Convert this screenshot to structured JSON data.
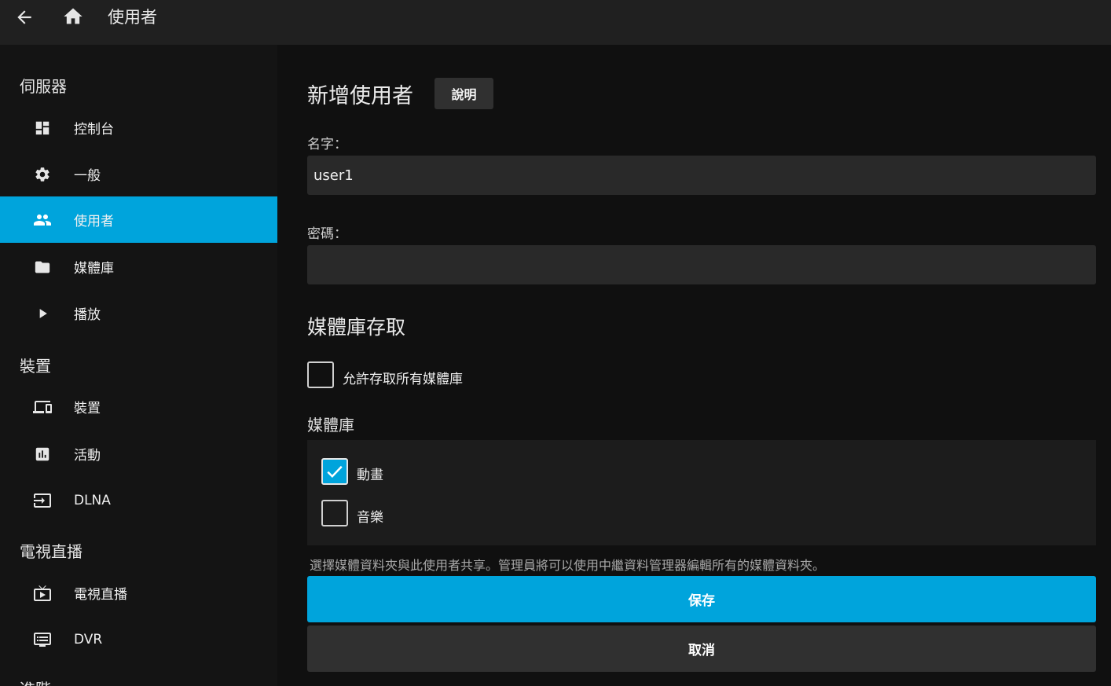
{
  "header": {
    "back_icon": "arrow-left-icon",
    "home_icon": "home-icon",
    "title": "使用者"
  },
  "sidebar": {
    "sections": [
      {
        "title": "伺服器"
      },
      {
        "title": "裝置"
      },
      {
        "title": "電視直播"
      },
      {
        "title": "進階"
      }
    ],
    "items": [
      {
        "label": "控制台",
        "icon": "dashboard-icon"
      },
      {
        "label": "一般",
        "icon": "gear-icon"
      },
      {
        "label": "使用者",
        "icon": "people-icon",
        "active": true
      },
      {
        "label": "媒體庫",
        "icon": "folder-icon"
      },
      {
        "label": "播放",
        "icon": "play-icon"
      },
      {
        "label": "裝置",
        "icon": "devices-icon"
      },
      {
        "label": "活動",
        "icon": "chart-icon"
      },
      {
        "label": "DLNA",
        "icon": "input-icon"
      },
      {
        "label": "電視直播",
        "icon": "tv-icon"
      },
      {
        "label": "DVR",
        "icon": "dvr-icon"
      }
    ]
  },
  "main": {
    "heading": "新增使用者",
    "help_label": "說明",
    "name_label": "名字：",
    "name_value": "user1",
    "password_label": "密碼：",
    "password_value": "",
    "library_access_heading": "媒體庫存取",
    "allow_all_label": "允許存取所有媒體庫",
    "allow_all_checked": false,
    "libraries_label": "媒體庫",
    "libraries": [
      {
        "name": "動畫",
        "checked": true
      },
      {
        "name": "音樂",
        "checked": false
      }
    ],
    "hint": "選擇媒體資料夾與此使用者共享。管理員將可以使用中繼資料管理器編輯所有的媒體資料夾。",
    "save_label": "保存",
    "cancel_label": "取消"
  },
  "colors": {
    "accent": "#00a4dc",
    "background": "#101010",
    "topbar": "#202020",
    "input": "#292929"
  }
}
